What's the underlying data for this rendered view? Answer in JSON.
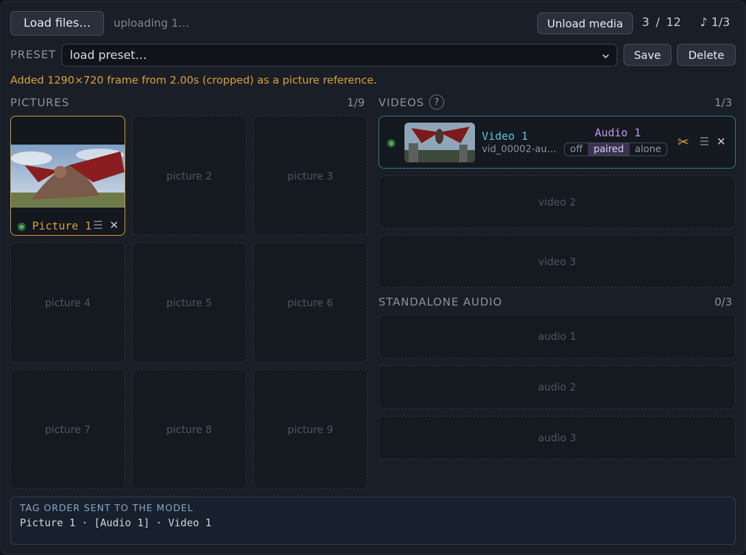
{
  "toolbar": {
    "load_label": "Load files…",
    "upload_status": "uploading 1…",
    "unload_label": "Unload media",
    "count": "3 / 12",
    "audio_count": "♪ 1/3"
  },
  "preset": {
    "label": "PRESET",
    "select_value": "load preset…",
    "save_label": "Save",
    "delete_label": "Delete"
  },
  "notice": "Added 1290×720 frame from 2.00s (cropped) as a picture reference.",
  "pictures": {
    "label": "PICTURES",
    "count": "1/9",
    "filled": {
      "name": "Picture 1"
    },
    "empty_slots": [
      "picture 2",
      "picture 3",
      "picture 4",
      "picture 5",
      "picture 6",
      "picture 7",
      "picture 8",
      "picture 9"
    ]
  },
  "videos": {
    "label": "VIDEOS",
    "help": "?",
    "count": "1/3",
    "filled": {
      "name": "Video 1",
      "file": "vid_00002-au…",
      "audio_name": "Audio 1",
      "modes": [
        "off",
        "paired",
        "alone"
      ],
      "active_mode": "paired"
    },
    "empty_slots": [
      "video 2",
      "video 3"
    ]
  },
  "audio": {
    "label": "STANDALONE AUDIO",
    "count": "0/3",
    "empty_slots": [
      "audio 1",
      "audio 2",
      "audio 3"
    ]
  },
  "tag_order": {
    "label": "TAG ORDER SENT TO THE MODEL",
    "value": "Picture 1 · [Audio 1] · Video 1"
  },
  "colors": {
    "accent_gold": "#d8a13a",
    "video_border": "#3c7c8a",
    "video_name": "#5ec4e0",
    "audio_name": "#c597e8",
    "status_green": "#4caf5a"
  }
}
